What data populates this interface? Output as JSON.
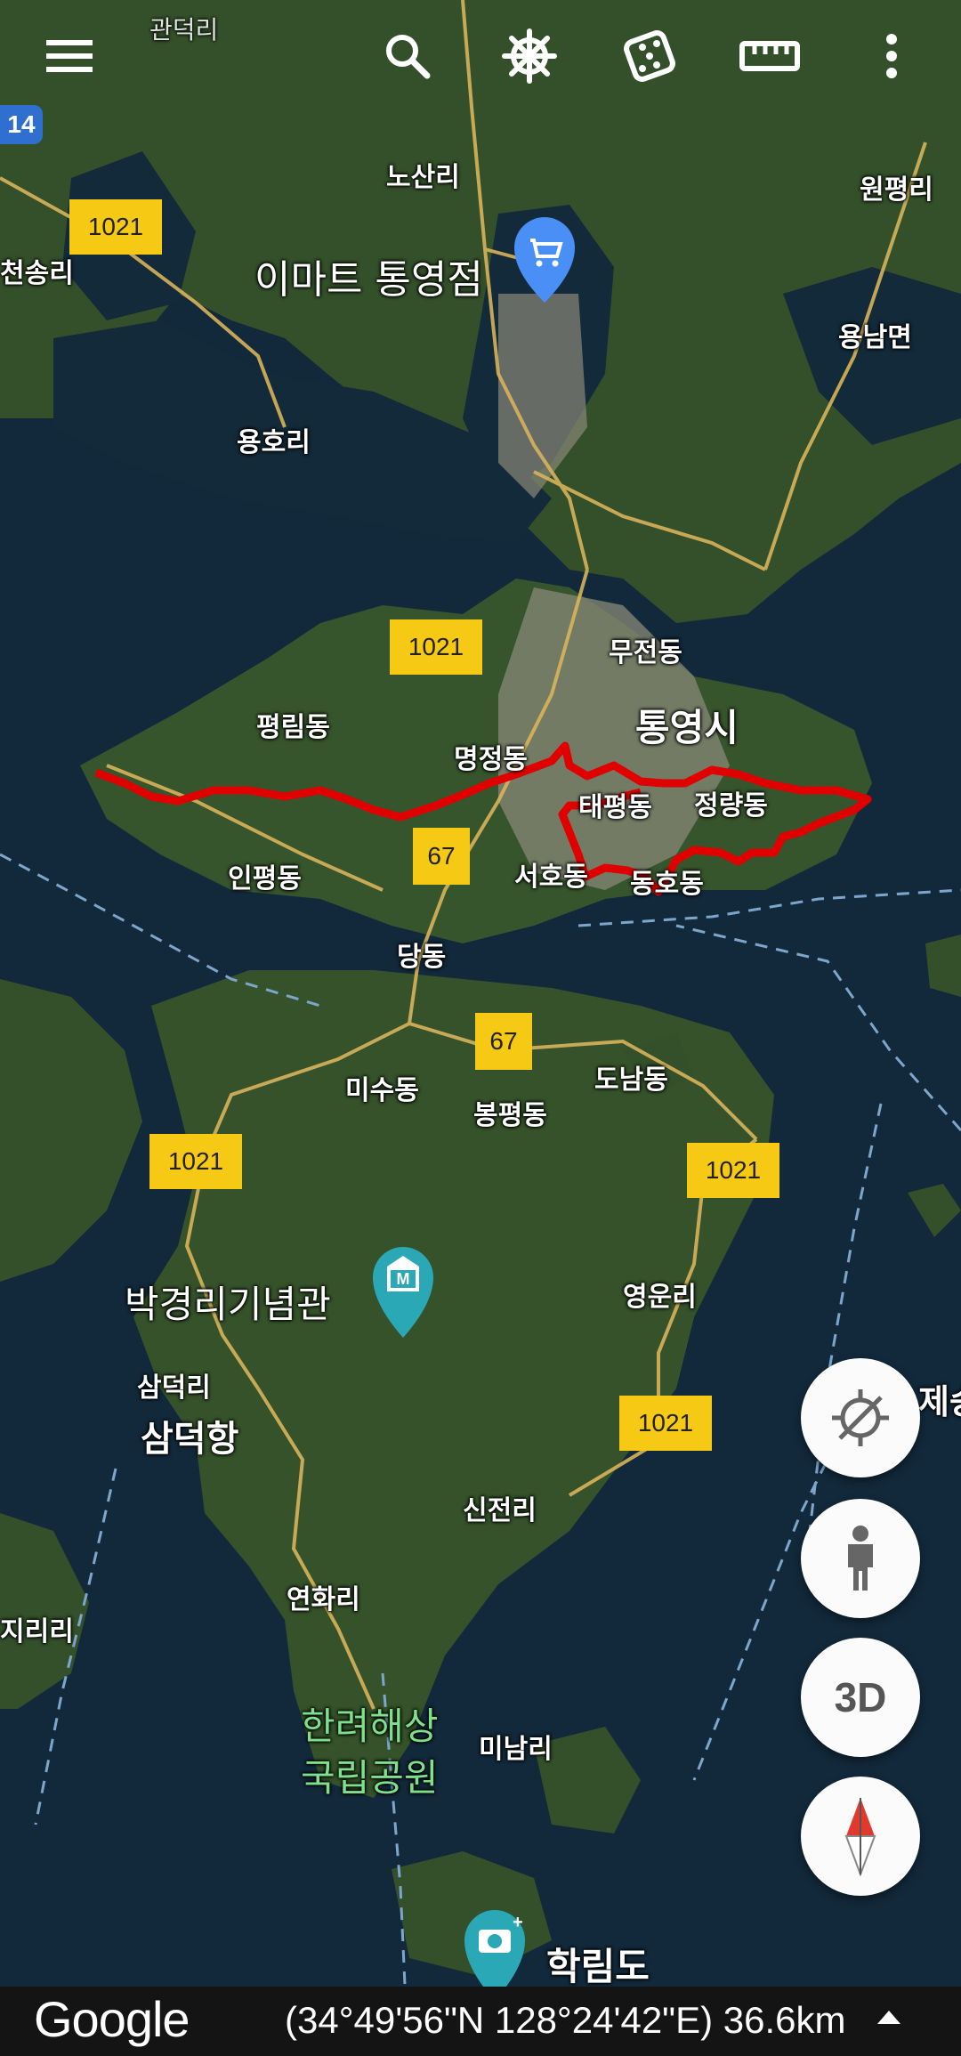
{
  "toolbar": {
    "icons": [
      "menu-icon",
      "search-icon",
      "helm-icon",
      "dice-icon",
      "ruler-icon",
      "more-vert-icon"
    ]
  },
  "map": {
    "route_color": "#e00000",
    "place_labels": [
      {
        "id": "gwandeok",
        "text": "관덕리"
      },
      {
        "id": "nosan",
        "text": "노산리"
      },
      {
        "id": "wonpyeong",
        "text": "원평리"
      },
      {
        "id": "songri",
        "text": "천송리"
      },
      {
        "id": "yongnam",
        "text": "용남면"
      },
      {
        "id": "yongho",
        "text": "용호리"
      },
      {
        "id": "mujeon",
        "text": "무전동"
      },
      {
        "id": "tongyeong",
        "text": "통영시"
      },
      {
        "id": "pyeongrim",
        "text": "평림동"
      },
      {
        "id": "myeongjeong",
        "text": "명정동"
      },
      {
        "id": "taepyeong",
        "text": "태평동"
      },
      {
        "id": "jeongryang",
        "text": "정량동"
      },
      {
        "id": "inpyeong",
        "text": "인평동"
      },
      {
        "id": "seoho",
        "text": "서호동"
      },
      {
        "id": "dongho",
        "text": "동호동"
      },
      {
        "id": "dang",
        "text": "당동"
      },
      {
        "id": "misu",
        "text": "미수동"
      },
      {
        "id": "donam",
        "text": "도남동"
      },
      {
        "id": "bongpyeong",
        "text": "봉평동"
      },
      {
        "id": "yeongun",
        "text": "영운리"
      },
      {
        "id": "samdeokri",
        "text": "삼덕리"
      },
      {
        "id": "samdeokhang",
        "text": "삼덕항"
      },
      {
        "id": "jeseung",
        "text": "제승"
      },
      {
        "id": "sinjeon",
        "text": "신전리"
      },
      {
        "id": "yeonhwa",
        "text": "연화리"
      },
      {
        "id": "jiri",
        "text": "지리리"
      },
      {
        "id": "minam",
        "text": "미남리"
      },
      {
        "id": "hallyeo1",
        "text": "한려해상"
      },
      {
        "id": "hallyeo2",
        "text": "국립공원"
      },
      {
        "id": "hakrim",
        "text": "학림도"
      },
      {
        "id": "emart",
        "text": "이마트 통영점"
      },
      {
        "id": "museum",
        "text": "박경리기념관"
      }
    ],
    "road_shields": [
      {
        "id": "r14",
        "text": "14"
      },
      {
        "id": "r1021a",
        "text": "1021"
      },
      {
        "id": "r1021b",
        "text": "1021"
      },
      {
        "id": "r67a",
        "text": "67"
      },
      {
        "id": "r67b",
        "text": "67"
      },
      {
        "id": "r1021c",
        "text": "1021"
      },
      {
        "id": "r1021d",
        "text": "1021"
      },
      {
        "id": "r1021e",
        "text": "1021"
      }
    ]
  },
  "controls": {
    "three_d_label": "3D"
  },
  "bottom_bar": {
    "brand": "Google",
    "coordinates": "(34°49'56\"N 128°24'42\"E) 36.6km"
  }
}
